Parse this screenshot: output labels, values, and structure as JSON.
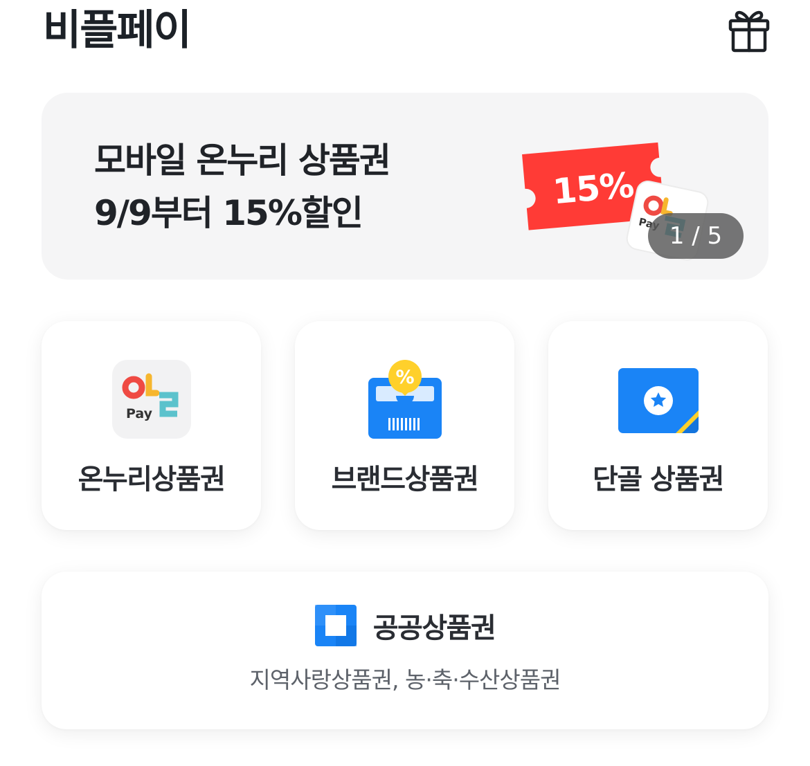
{
  "header": {
    "title": "비플페이",
    "gift_icon": "gift-icon"
  },
  "banner": {
    "line1": "모바일 온누리 상품권",
    "line2": "9/9부터 15%할인",
    "ticket_text": "15%",
    "logo_text": "Pay",
    "page_indicator": "1 / 5",
    "colors": {
      "ticket": "#ff3b36",
      "background": "#f5f5f6"
    }
  },
  "tiles": [
    {
      "label": "온누리상품권",
      "icon": "onnuri-pay-logo-icon",
      "logo_text": "Pay"
    },
    {
      "label": "브랜드상품권",
      "icon": "brand-voucher-icon",
      "badge": "%"
    },
    {
      "label": "단골 상품권",
      "icon": "regular-voucher-star-icon"
    }
  ],
  "public": {
    "title": "공공상품권",
    "subtitle": "지역사랑상품권, 농·축·수산상품권",
    "icon": "public-voucher-square-icon"
  },
  "colors": {
    "blue": "#1a84f6",
    "yellow": "#ffd02b",
    "red": "#ef4a43",
    "teal": "#5cc2cc"
  }
}
